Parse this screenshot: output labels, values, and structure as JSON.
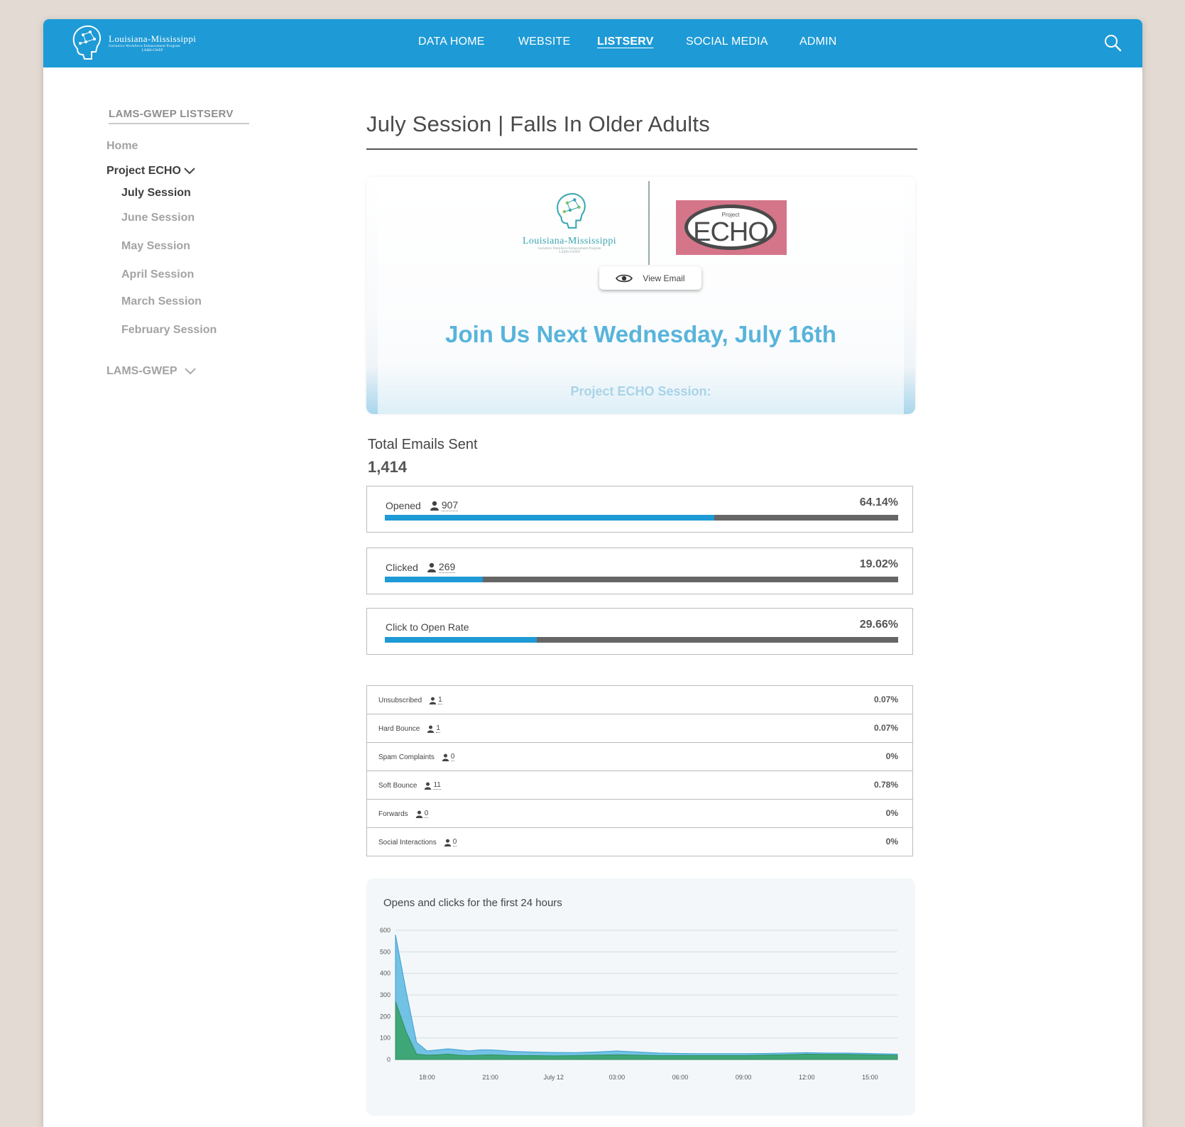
{
  "brand": {
    "line1": "Louisiana-Mississippi",
    "line2": "Geriatrics Workforce Enhancement Program",
    "line3": "LAMS-GWEP"
  },
  "nav": {
    "items": [
      {
        "label": "DATA HOME",
        "active": false
      },
      {
        "label": "WEBSITE",
        "active": false
      },
      {
        "label": "LISTSERV",
        "active": true
      },
      {
        "label": "SOCIAL MEDIA",
        "active": false
      },
      {
        "label": "ADMIN",
        "active": false
      }
    ]
  },
  "sidebar": {
    "title": "LAMS-GWEP LISTSERV",
    "home": "Home",
    "group1": "Project ECHO",
    "sessions": [
      "July Session",
      "June Session",
      "May Session",
      "April Session",
      "March Session",
      "February Session"
    ],
    "group2": "LAMS-GWEP"
  },
  "page": {
    "title": "July Session | Falls In Older Adults"
  },
  "preview": {
    "logo_line1": "Louisiana-Mississippi",
    "logo_line2": "Geriatrics Workforce Enhancement Program",
    "logo_line3": "LAMS-GWEP",
    "echo_small": "Project",
    "echo_big": "ECHO",
    "view_email": "View Email",
    "headline": "Join Us Next Wednesday, July 16th",
    "subheadline": "Project ECHO Session:"
  },
  "stats": {
    "total_label": "Total Emails Sent",
    "total_value": "1,414",
    "main": [
      {
        "label": "Opened",
        "count": "907",
        "pct": "64.14%",
        "fraction": 0.6414
      },
      {
        "label": "Clicked",
        "count": "269",
        "pct": "19.02%",
        "fraction": 0.1902
      },
      {
        "label": "Click to Open Rate",
        "count": "",
        "pct": "29.66%",
        "fraction": 0.2966
      }
    ],
    "rows": [
      {
        "label": "Unsubscribed",
        "count": "1",
        "pct": "0.07%"
      },
      {
        "label": "Hard Bounce",
        "count": "1",
        "pct": "0.07%"
      },
      {
        "label": "Spam Complaints",
        "count": "0",
        "pct": "0%"
      },
      {
        "label": "Soft Bounce",
        "count": "11",
        "pct": "0.78%"
      },
      {
        "label": "Forwards",
        "count": "0",
        "pct": "0%"
      },
      {
        "label": "Social Interactions",
        "count": "0",
        "pct": "0%"
      }
    ]
  },
  "colors": {
    "brand": "#1e9ad6",
    "opens": "#5bb8e0",
    "clicks": "#3aa36b"
  },
  "chart_data": {
    "type": "area",
    "title": "Opens and clicks for the first 24 hours",
    "ylim": [
      0,
      600
    ],
    "yticks": [
      0,
      100,
      200,
      300,
      400,
      500,
      600
    ],
    "xlim": [
      16.5,
      40.3
    ],
    "xticks": [
      {
        "value": 18,
        "label": "18:00"
      },
      {
        "value": 21,
        "label": "21:00"
      },
      {
        "value": 24,
        "label": "July 12"
      },
      {
        "value": 27,
        "label": "03:00"
      },
      {
        "value": 30,
        "label": "06:00"
      },
      {
        "value": 33,
        "label": "09:00"
      },
      {
        "value": 36,
        "label": "12:00"
      },
      {
        "value": 39,
        "label": "15:00"
      }
    ],
    "series": [
      {
        "x": [
          16.5,
          17.0,
          17.5,
          18.0,
          18.5,
          19.0,
          19.5,
          20.0,
          20.5,
          21.0,
          21.5,
          22,
          23,
          24,
          25,
          26,
          27,
          28,
          29,
          30,
          31,
          32,
          33,
          34,
          35,
          36,
          37,
          38,
          39,
          40.3
        ],
        "values": [
          580,
          320,
          80,
          40,
          45,
          50,
          45,
          40,
          45,
          45,
          42,
          38,
          35,
          33,
          32,
          35,
          40,
          35,
          30,
          28,
          27,
          27,
          27,
          28,
          30,
          32,
          30,
          30,
          28,
          25
        ]
      },
      {
        "x": [
          16.5,
          17.0,
          17.5,
          18.0,
          18.5,
          19.0,
          19.5,
          20.0,
          20.5,
          21.0,
          21.5,
          22,
          23,
          24,
          25,
          26,
          27,
          28,
          29,
          30,
          31,
          32,
          33,
          34,
          35,
          36,
          37,
          38,
          39,
          40.3
        ],
        "values": [
          270,
          130,
          25,
          20,
          22,
          25,
          20,
          18,
          20,
          22,
          20,
          18,
          18,
          17,
          18,
          20,
          22,
          20,
          18,
          18,
          18,
          18,
          18,
          20,
          22,
          25,
          24,
          24,
          22,
          20
        ]
      }
    ]
  }
}
